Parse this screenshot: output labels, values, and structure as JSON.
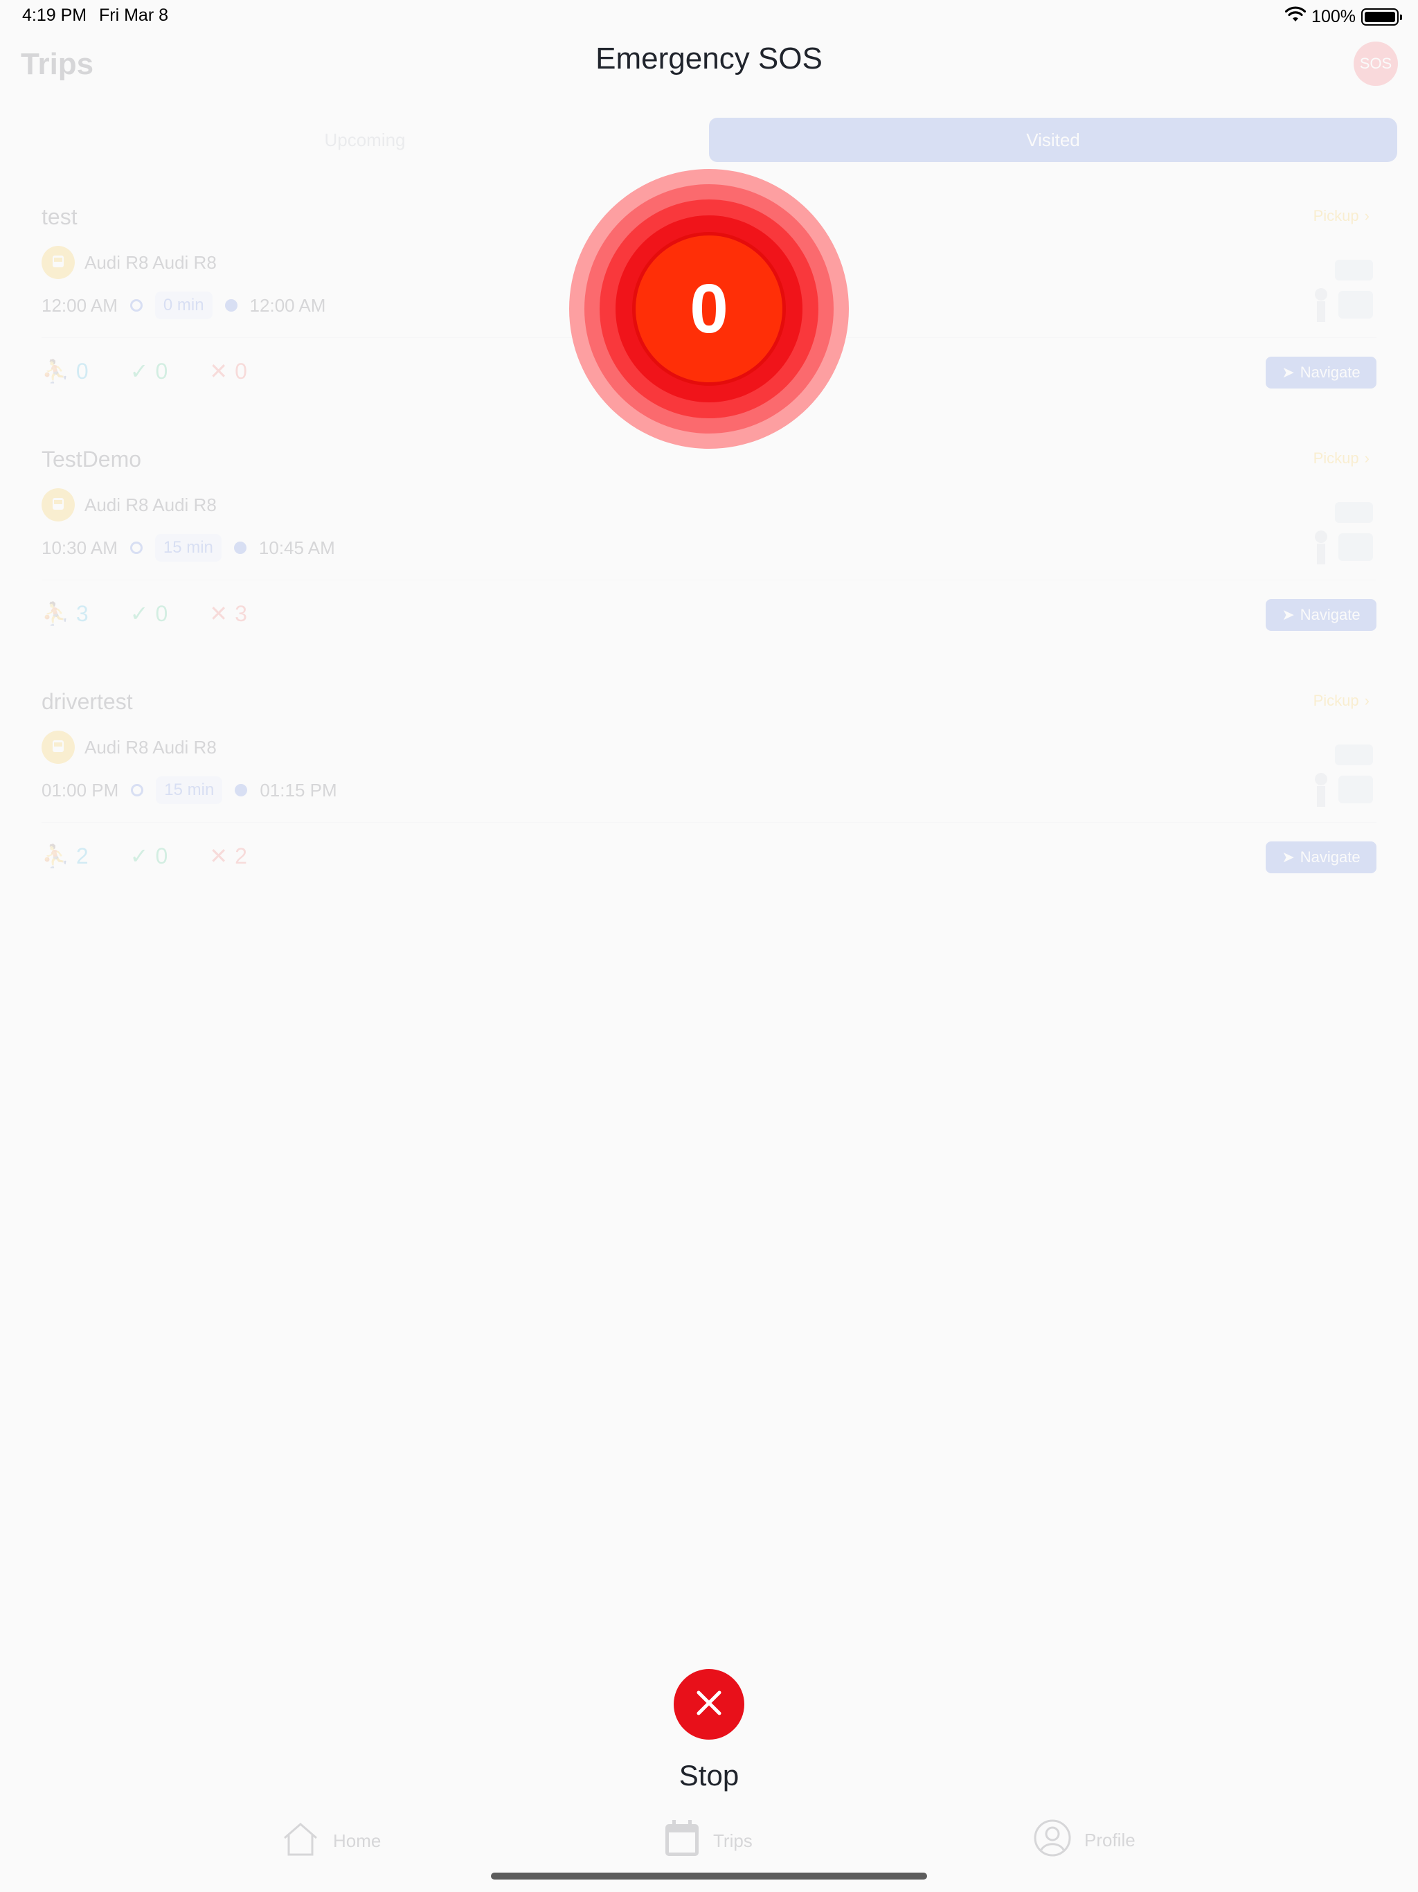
{
  "status_bar": {
    "time": "4:19 PM",
    "date": "Fri Mar 8",
    "battery": "100%"
  },
  "header": {
    "title": "Trips",
    "sos_badge": "SOS"
  },
  "tabs": [
    {
      "label": "Upcoming",
      "active": false
    },
    {
      "label": "Visited",
      "active": true
    }
  ],
  "trips": [
    {
      "name": "test",
      "status": "Pickup",
      "vehicle": "Audi R8 Audi R8",
      "start": "12:00 AM",
      "duration": "0 min",
      "end": "12:00 AM",
      "total": "0",
      "done": "0",
      "missed": "0",
      "navigate": "Navigate"
    },
    {
      "name": "TestDemo",
      "status": "Pickup",
      "vehicle": "Audi R8 Audi R8",
      "start": "10:30 AM",
      "duration": "15 min",
      "end": "10:45 AM",
      "total": "3",
      "done": "0",
      "missed": "3",
      "navigate": "Navigate"
    },
    {
      "name": "drivertest",
      "status": "Pickup",
      "vehicle": "Audi R8 Audi R8",
      "start": "01:00 PM",
      "duration": "15 min",
      "end": "01:15 PM",
      "total": "2",
      "done": "0",
      "missed": "2",
      "navigate": "Navigate"
    }
  ],
  "tab_bar": [
    {
      "label": "Home",
      "icon": "home-icon"
    },
    {
      "label": "Trips",
      "icon": "calendar-icon"
    },
    {
      "label": "Profile",
      "icon": "user-icon"
    }
  ],
  "overlay": {
    "title": "Emergency SOS",
    "countdown": "0",
    "stop_label": "Stop"
  },
  "colors": {
    "sos_red": "#ff2f07",
    "stop_red": "#e8101a",
    "accent_blue": "#3056d3",
    "pickup_yellow": "#f5b300"
  }
}
